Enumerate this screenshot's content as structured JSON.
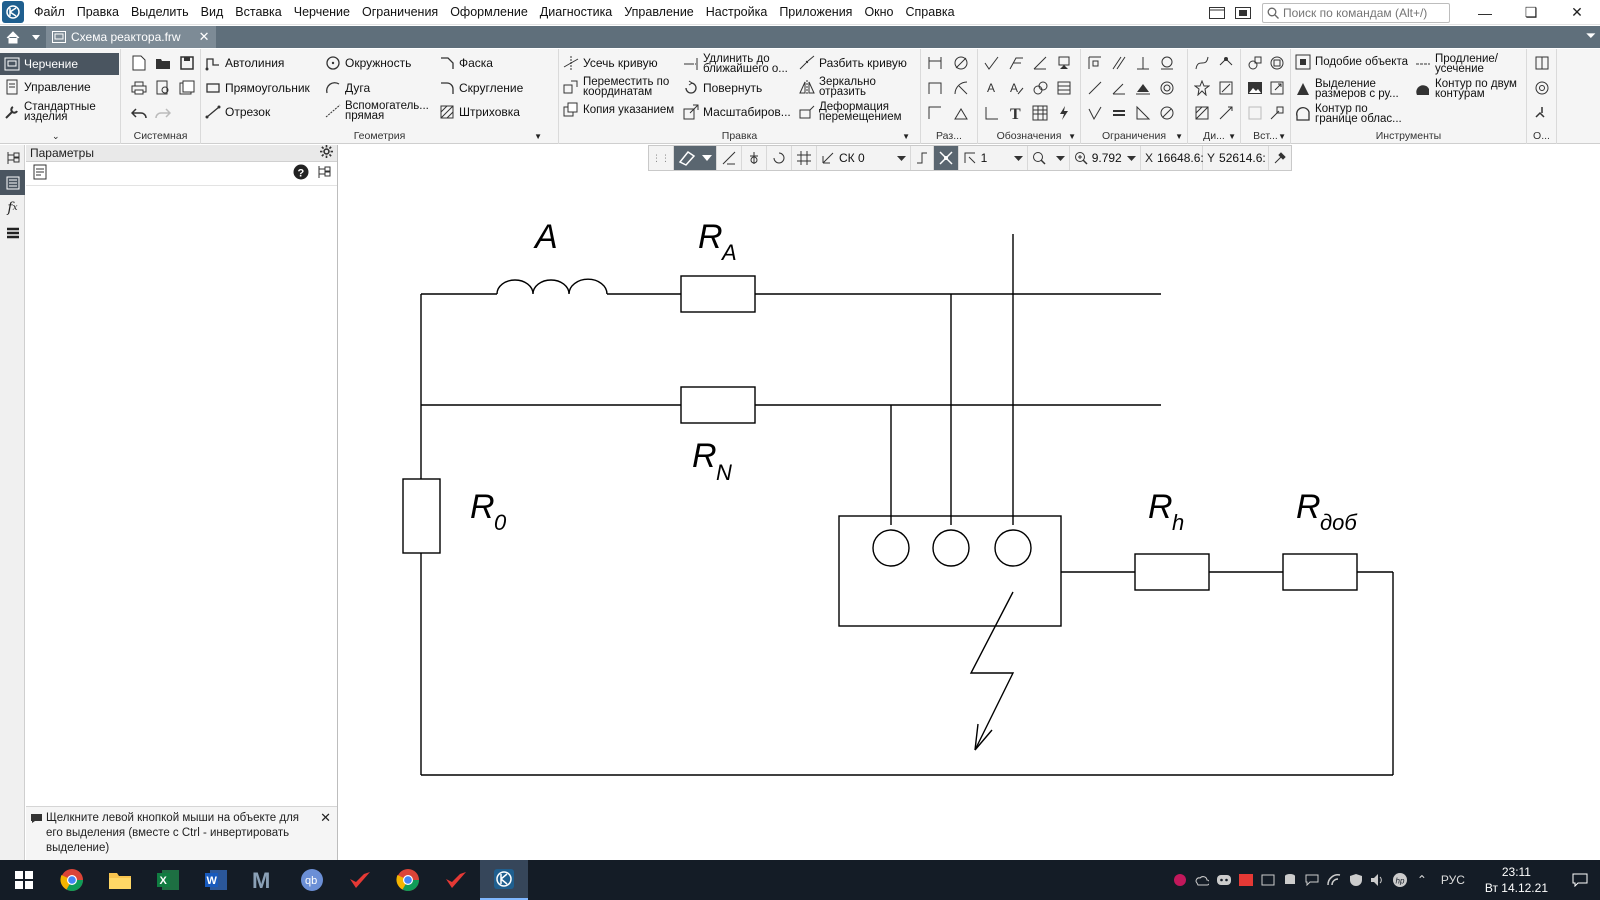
{
  "menu": {
    "items": [
      "Файл",
      "Правка",
      "Выделить",
      "Вид",
      "Вставка",
      "Черчение",
      "Ограничения",
      "Оформление",
      "Диагностика",
      "Управление",
      "Настройка",
      "Приложения",
      "Окно",
      "Справка"
    ],
    "search_placeholder": "Поиск по командам (Alt+/)"
  },
  "tabs": {
    "document": "Схема реактора.frw"
  },
  "ribbon": {
    "modes": [
      "Черчение",
      "Управление",
      "Стандартные изделия"
    ],
    "groups": {
      "system": "Системная",
      "geometry": "Геометрия",
      "edit": "Правка",
      "razm": "Раз...",
      "designations": "Обозначения",
      "constraints": "Ограничения",
      "di": "Ди...",
      "vst": "Вст...",
      "tools": "Инструменты",
      "o": "О..."
    },
    "geometry": [
      "Автолиния",
      "Прямоугольник",
      "Отрезок",
      "Окружность",
      "Дуга",
      "Вспомогатель... прямая",
      "Фаска",
      "Скругление",
      "Штриховка"
    ],
    "edit": [
      "Усечь кривую",
      "Переместить по координатам",
      "Копия указанием",
      "Удлинить до ближайшего о...",
      "Повернуть",
      "Масштабиров...",
      "Разбить кривую",
      "Зеркально отразить",
      "Деформация перемещением"
    ],
    "tools": [
      "Подобие объекта",
      "Выделение размеров с ру...",
      "Контур по границе облас...",
      "Продление/ усечение",
      "Контур по двум контурам"
    ]
  },
  "params": {
    "title": "Параметры",
    "hint": "Щелкните левой кнопкой мыши на объекте для его выделения (вместе с Ctrl - инвертировать выделение)"
  },
  "snap": {
    "cs": "СК 0",
    "step": "1",
    "zoom": "9.792",
    "x_label": "X",
    "x_value": "16648.6:",
    "y_label": "Y",
    "y_value": "52614.6:"
  },
  "drawing": {
    "labels": {
      "A": "A",
      "RA": "R",
      "RA_sub": "A",
      "RN": "R",
      "RN_sub": "N",
      "R0": "R",
      "R0_sub": "0",
      "Rh": "R",
      "Rh_sub": "h",
      "Rdob": "R",
      "Rdob_sub": "доб"
    }
  },
  "taskbar": {
    "lang": "РУС",
    "time": "23:11",
    "date": "Вт 14.12.21"
  },
  "colors": {
    "accent": "#1f5f8f",
    "tabstrip": "#5f6f7b",
    "taskbar": "#141c26"
  }
}
